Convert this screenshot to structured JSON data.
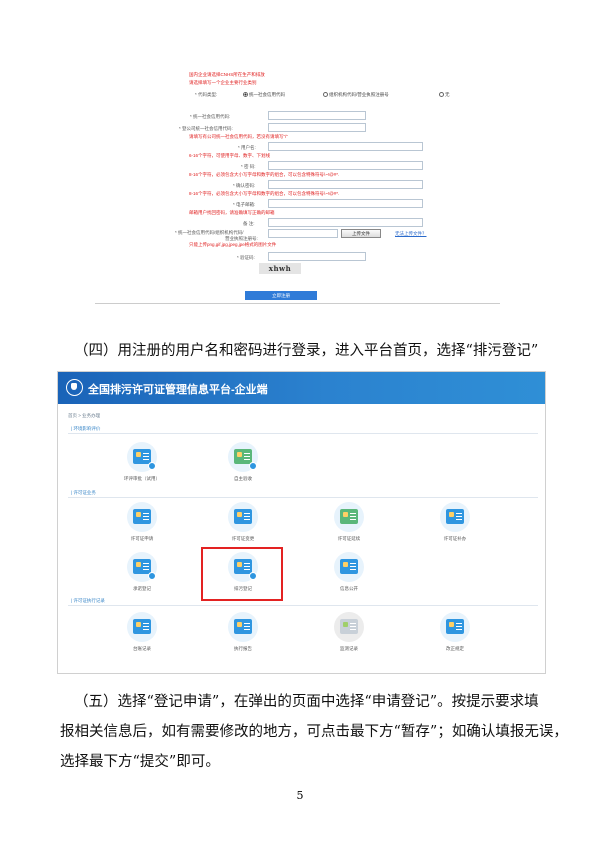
{
  "registration_form": {
    "note_top_1": "国内企业请选择CNHS所在生产和排放",
    "note_top_2": "请选择填写一个企业主要行业类别",
    "org_type_label": "* 代码类型:",
    "org_type_options": [
      "统一社会信用代码",
      "组织机构代码/营业执照注册号",
      "无"
    ],
    "credit_code_label": "* 统一社会信用代码:",
    "confirm_credit_label": "* 登公司统一社会信用代码:",
    "confirm_credit_note": "请填写有公司统一社会信用代码，若没有请填写“/”",
    "username_label": "* 用户名:",
    "username_note": "6-16个字符，可使用字母、数字、下划线",
    "password_label": "* 密 码:",
    "password_note": "8-16个字符，必须包含大小写字母和数字的组合，可以包含特殊符号\\~!@#*.",
    "confirm_password_label": "* 确认密码:",
    "confirm_password_note": "8-16个字符，必须包含大小写字母和数字的组合，可以包含特殊符号\\~!@#*.",
    "email_label": "* 电子邮箱:",
    "email_note": "邮箱用户找回密码，请准确填写正确的邮箱",
    "remark_label": "备 注:",
    "file_label_1": "* 统一社会信用代码/组织机构代码/",
    "file_label_2": "营业执照注册号:",
    "upload_button": "上传文件",
    "upload_link": "无法上传文件？",
    "file_note": "只能上传png,gif,jpg,jpeg,jpe格式的图片文件",
    "captcha_label": "* 验证码:",
    "captcha_text": "xhwh",
    "submit_button": "立即注册"
  },
  "paragraph_4": "（四）用注册的用户名和密码进行登录，进入平台首页，选择“排污登记”",
  "platform": {
    "title": "全国排污许可证管理信息平台-企业端",
    "breadcrumb": "首页 > 业务办理",
    "sections": [
      {
        "title": "| 环境影响评价",
        "modules": [
          {
            "label": "环评审批（试用）"
          },
          {
            "label": "自主验收"
          }
        ]
      },
      {
        "title": "| 许可证业务",
        "modules": [
          {
            "label": "许可证申请"
          },
          {
            "label": "许可证变更"
          },
          {
            "label": "许可证延续"
          },
          {
            "label": "许可证补办"
          },
          {
            "label": "承诺登记"
          },
          {
            "label": "排污登记"
          },
          {
            "label": "信息公开"
          }
        ]
      },
      {
        "title": "| 许可证执行记录",
        "modules": [
          {
            "label": "台账记录"
          },
          {
            "label": "执行报告"
          },
          {
            "label": "监测记录"
          },
          {
            "label": "改正规定"
          }
        ]
      }
    ],
    "highlighted_module": "排污登记",
    "highlight_color": "#e32222",
    "header_color": "#1a63b8"
  },
  "paragraph_5": [
    "（五）选择“登记申请”，在弹出的页面中选择“申请登记”。按提示要求填",
    "报相关信息后，如有需要修改的地方，可点击最下方“暂存”；如确认填报无误，",
    "选择最下方“提交”即可。"
  ],
  "page_number": "5"
}
